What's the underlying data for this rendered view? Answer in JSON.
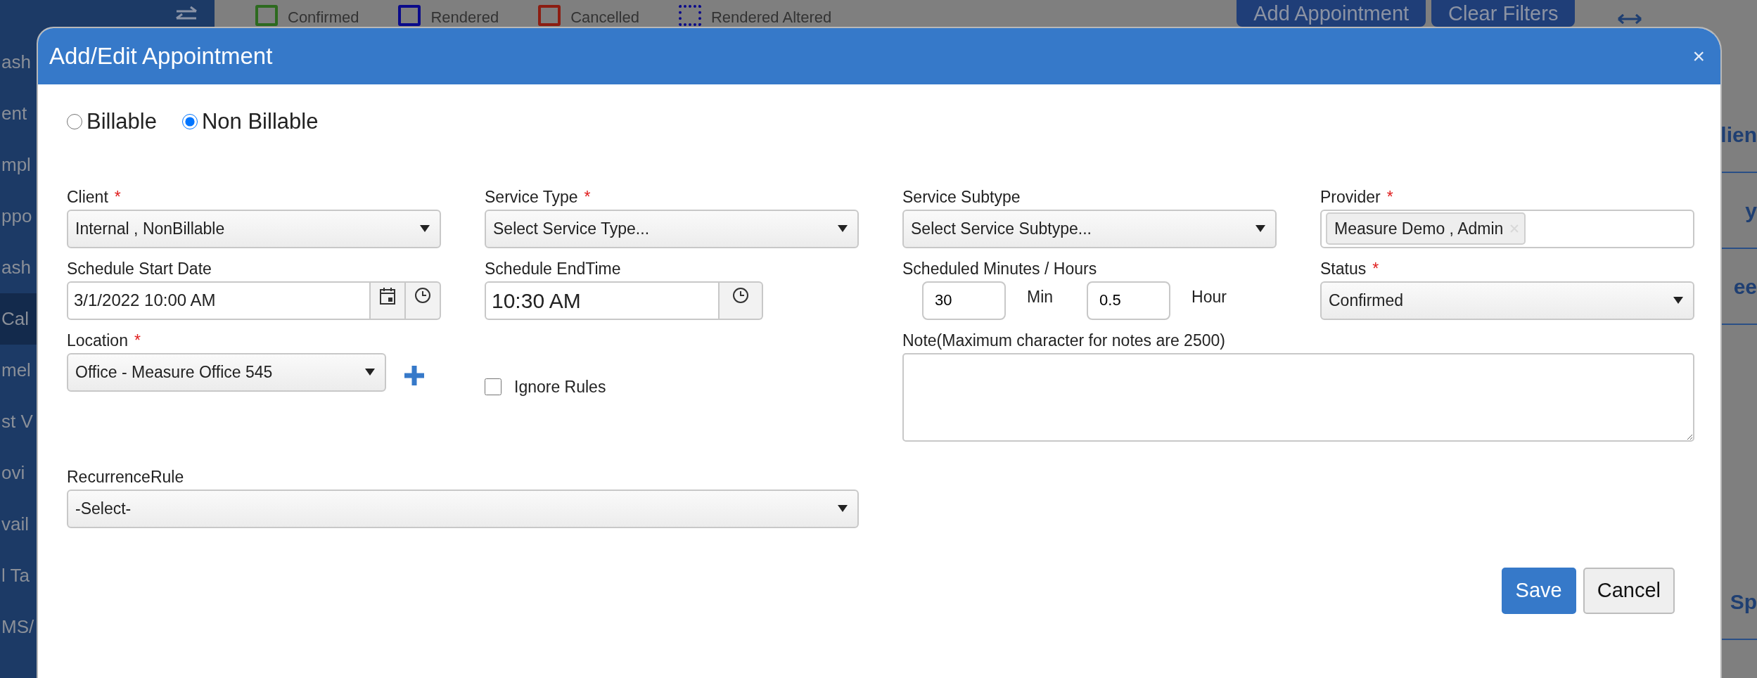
{
  "sidebar": {
    "items": [
      {
        "label": "ash",
        "selected": false
      },
      {
        "label": "ent",
        "selected": false
      },
      {
        "label": "mpl",
        "selected": false
      },
      {
        "label": "ppo",
        "selected": false
      },
      {
        "label": "ash",
        "selected": false
      },
      {
        "label": "Cal",
        "selected": true
      },
      {
        "label": "mel",
        "selected": false
      },
      {
        "label": "st V",
        "selected": false
      },
      {
        "label": "ovi",
        "selected": false
      },
      {
        "label": "vail",
        "selected": false
      },
      {
        "label": "l Ta",
        "selected": false
      },
      {
        "label": "MS/",
        "selected": false
      }
    ]
  },
  "legend": [
    {
      "label": "Confirmed",
      "color": "#2d6a1f",
      "kind": "solid"
    },
    {
      "label": "Rendered",
      "color": "#0a0a8a",
      "kind": "solid"
    },
    {
      "label": "Cancelled",
      "color": "#8c1d12",
      "kind": "solid"
    },
    {
      "label": "Rendered Altered",
      "color": "#0a0a8a",
      "kind": "dotted"
    }
  ],
  "toolbar": {
    "buttons": [
      "Add Appointment",
      "Clear Filters"
    ]
  },
  "side_panel": {
    "items": [
      "lien",
      "y",
      "ee",
      "Sp"
    ]
  },
  "dialog": {
    "title": "Add/Edit Appointment",
    "close": "×",
    "required_mark": "*",
    "billing": [
      {
        "label": "Billable",
        "selected": false
      },
      {
        "label": "Non Billable",
        "selected": true
      }
    ],
    "fields": [
      {
        "kind": "select",
        "label": "Client",
        "required": true,
        "value": "Internal , NonBillable"
      },
      {
        "kind": "select",
        "label": "Service Type",
        "required": true,
        "value": "Select Service Type..."
      },
      {
        "kind": "select",
        "label": "Service Subtype",
        "required": false,
        "value": "Select Service Subtype..."
      },
      {
        "kind": "tags",
        "label": "Provider",
        "required": true,
        "tags": [
          "Measure Demo , Admin"
        ]
      },
      {
        "kind": "datetime",
        "label": "Schedule Start Date",
        "required": false,
        "value": "3/1/2022 10:00 AM"
      },
      {
        "kind": "time",
        "label": "Schedule EndTime",
        "required": false,
        "value": "10:30 AM"
      },
      {
        "kind": "duration",
        "label": "Scheduled Minutes / Hours",
        "required": false,
        "minutes": "30",
        "minutes_unit": "Min",
        "hours": "0.5",
        "hours_unit": "Hour"
      },
      {
        "kind": "select",
        "label": "Status",
        "required": true,
        "value": "Confirmed"
      },
      {
        "kind": "select_add",
        "label": "Location",
        "required": true,
        "value": "Office - Measure Office 545"
      },
      {
        "kind": "checkbox",
        "label": "Ignore Rules",
        "checked": false
      },
      {
        "kind": "textarea",
        "label": "Note(Maximum character for notes are 2500)",
        "required": false
      },
      {
        "kind": "wide_select",
        "label": "RecurrenceRule",
        "required": false,
        "value": "-Select-"
      }
    ],
    "buttons": [
      {
        "label": "Save",
        "kind": "primary"
      },
      {
        "label": "Cancel",
        "kind": "secondary"
      }
    ]
  }
}
